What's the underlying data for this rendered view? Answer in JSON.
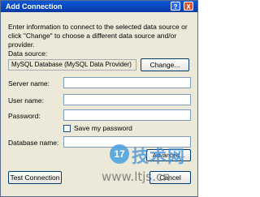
{
  "window": {
    "title": "Add Connection",
    "help_glyph": "?",
    "close_glyph": "X"
  },
  "info_text": "Enter information to connect to the selected data source or click \"Change\" to choose a different data source and/or provider.",
  "data_source": {
    "label": "Data source:",
    "value": "MySQL Database (MySQL Data Provider)",
    "change_button": "Change..."
  },
  "fields": {
    "server_name_label": "Server name:",
    "user_name_label": "User name:",
    "password_label": "Password:",
    "save_password_label": "Save my password",
    "database_name_label": "Database name:"
  },
  "buttons": {
    "advanced": "Advanced...",
    "test_connection": "Test Connection",
    "cancel": "Cancel"
  },
  "watermark": {
    "logo_number": "17",
    "chinese_text": "技术网",
    "url": "www.ltjs.cn"
  }
}
